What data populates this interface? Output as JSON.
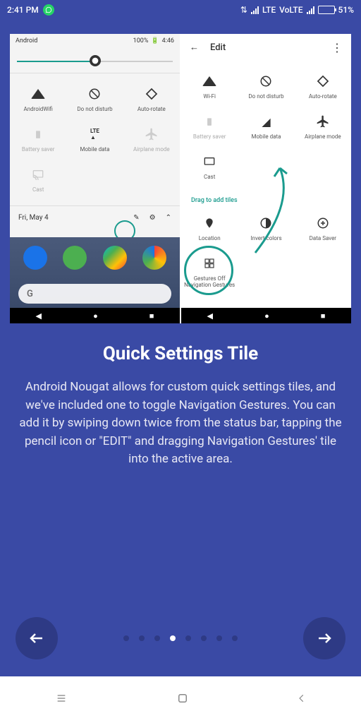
{
  "statusbar": {
    "time": "2:41 PM",
    "lte": "LTE",
    "volte": "VoLTE",
    "battery": "51%"
  },
  "shot1": {
    "sb": {
      "name": "Android",
      "batt": "100%",
      "time": "4:46"
    },
    "tiles": [
      {
        "label": "AndroidWifi",
        "dim": false
      },
      {
        "label": "Do not disturb",
        "dim": false
      },
      {
        "label": "Auto-rotate",
        "dim": false
      },
      {
        "label": "Battery saver",
        "dim": true
      },
      {
        "label": "Mobile data",
        "dim": false
      },
      {
        "label": "Airplane mode",
        "dim": true
      },
      {
        "label": "Cast",
        "dim": true
      }
    ],
    "date": "Fri, May 4",
    "gbar": "G"
  },
  "shot2": {
    "edit": "Edit",
    "tiles": [
      {
        "label": "Wi-Fi"
      },
      {
        "label": "Do not disturb"
      },
      {
        "label": "Auto-rotate"
      },
      {
        "label": "Battery saver",
        "dim": true
      },
      {
        "label": "Mobile data"
      },
      {
        "label": "Airplane mode"
      },
      {
        "label": "Cast"
      }
    ],
    "drag": "Drag to add tiles",
    "tiles2": [
      {
        "label": "Location"
      },
      {
        "label": "Invert colors"
      },
      {
        "label": "Data Saver"
      }
    ],
    "gest": {
      "a": "Gestures Off",
      "b": "Navigation Gestures"
    }
  },
  "page": {
    "title": "Quick Settings Tile",
    "desc": "Android Nougat allows for custom quick settings tiles, and we've included one to toggle Navigation Gestures. You can add it by swiping down twice from the status bar, tapping the pencil icon or \"EDIT\" and dragging Navigation Gestures' tile into the active area."
  },
  "pager": {
    "total": 8,
    "active": 3
  }
}
